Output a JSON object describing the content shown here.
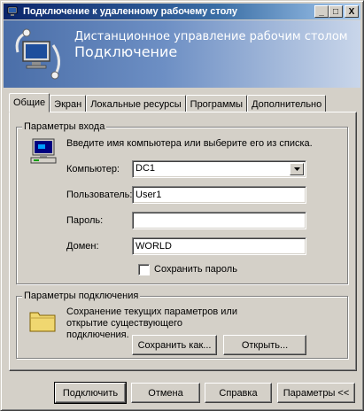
{
  "window": {
    "title": "Подключение к удаленному рабочему столу",
    "minimize": "_",
    "maximize": "□",
    "close": "X"
  },
  "banner": {
    "line1": "Дистанционное управление рабочим столом",
    "line2": "Подключение"
  },
  "tabs": [
    {
      "label": "Общие",
      "active": true
    },
    {
      "label": "Экран",
      "active": false
    },
    {
      "label": "Локальные ресурсы",
      "active": false
    },
    {
      "label": "Программы",
      "active": false
    },
    {
      "label": "Дополнительно",
      "active": false
    }
  ],
  "logon": {
    "legend": "Параметры входа",
    "hint": "Введите имя компьютера или выберите его из списка.",
    "computer_label": "Компьютер:",
    "computer_value": "DC1",
    "user_label": "Пользователь:",
    "user_value": "User1",
    "password_label": "Пароль:",
    "password_value": "",
    "domain_label": "Домен:",
    "domain_value": "WORLD",
    "save_password_label": "Сохранить пароль",
    "save_password_checked": false
  },
  "connection": {
    "legend": "Параметры подключения",
    "description": "Сохранение текущих параметров или открытие существующего подключения.",
    "save_as": "Сохранить как...",
    "open": "Открыть..."
  },
  "footer": {
    "connect": "Подключить",
    "cancel": "Отмена",
    "help": "Справка",
    "options": "Параметры <<"
  },
  "colors": {
    "title_gradient_start": "#0a246a",
    "banner_start": "#4a6ea8",
    "face": "#d4d0c8"
  },
  "icons": {
    "app": "remote-desktop-icon",
    "computer": "computer-icon",
    "folder": "folder-icon"
  }
}
